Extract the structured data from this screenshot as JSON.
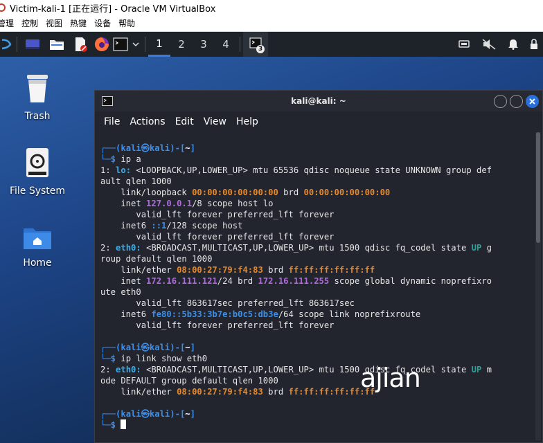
{
  "vbox": {
    "title": "Victim-kali-1 [正在运行] - Oracle VM VirtualBox",
    "menu": [
      "管理",
      "控制",
      "视图",
      "热键",
      "设备",
      "帮助"
    ]
  },
  "panel": {
    "workspaces": [
      "1",
      "2",
      "3",
      "4"
    ],
    "active_workspace": "1",
    "terminal_badge": "3"
  },
  "desktop": {
    "icons": [
      {
        "label": "Trash",
        "icon": "trash-icon"
      },
      {
        "label": "File System",
        "icon": "drive-icon"
      },
      {
        "label": "Home",
        "icon": "home-folder-icon"
      }
    ]
  },
  "terminal": {
    "title": "kali@kali: ~",
    "menu": [
      "File",
      "Actions",
      "Edit",
      "View",
      "Help"
    ],
    "prompt": {
      "user": "kali",
      "host": "kali",
      "cwd": "~",
      "symbol": "㉿"
    },
    "cmd1": "ip a",
    "cmd2": "ip link show eth0",
    "output": {
      "l1_num": "1:",
      "l1_if": "lo:",
      "l1_rest": " <LOOPBACK,UP,LOWER_UP> mtu 65536 qdisc noqueue state UNKNOWN group def",
      "l1_wrap": "ault qlen 1000",
      "lo_ether_pre": "    link/loopback ",
      "lo_mac": "00:00:00:00:00:00",
      "lo_brd": " brd ",
      "lo_brdmac": "00:00:00:00:00:00",
      "lo_inet_pre": "    inet ",
      "lo_ip": "127.0.0.1",
      "lo_inet_post": "/8 scope host lo",
      "valid1": "       valid_lft forever preferred_lft forever",
      "lo_inet6_pre": "    inet6 ",
      "lo_ip6": "::1",
      "lo_inet6_post": "/128 scope host",
      "valid2": "       valid_lft forever preferred_lft forever",
      "l2_num": "2:",
      "l2_if": "eth0:",
      "l2_rest": " <BROADCAST,MULTICAST,UP,LOWER_UP> mtu 1500 qdisc fq_codel state ",
      "l2_up": "UP",
      "l2_tail": " g",
      "l2_wrap": "roup default qlen 1000",
      "eth_pre": "    link/ether ",
      "eth_mac": "08:00:27:79:f4:83",
      "eth_brd": " brd ",
      "eth_brdmac": "ff:ff:ff:ff:ff:ff",
      "eth_inet_pre": "    inet ",
      "eth_ip": "172.16.111.121",
      "eth_mid": "/24 brd ",
      "eth_bcast": "172.16.111.255",
      "eth_inet_post": " scope global dynamic noprefixro",
      "eth_inet_wrap": "ute eth0",
      "valid3": "       valid_lft 863617sec preferred_lft 863617sec",
      "eth_inet6_pre": "    inet6 ",
      "eth_ip6": "fe80::5b33:3b7e:b0c5:db3e",
      "eth_inet6_post": "/64 scope link noprefixroute",
      "valid4": "       valid_lft forever preferred_lft forever",
      "s2_num": "2:",
      "s2_if": "eth0:",
      "s2_rest": " <BROADCAST,MULTICAST,UP,LOWER_UP> mtu 1500 qdisc fq_codel state ",
      "s2_up": "UP",
      "s2_tail": " m",
      "s2_wrap": "ode DEFAULT group default qlen 1000",
      "s2_ether_pre": "    link/ether ",
      "s2_mac": "08:00:27:79:f4:83",
      "s2_brd": " brd ",
      "s2_brdmac": "ff:ff:ff:ff:ff:ff"
    }
  },
  "watermark": "ajian"
}
